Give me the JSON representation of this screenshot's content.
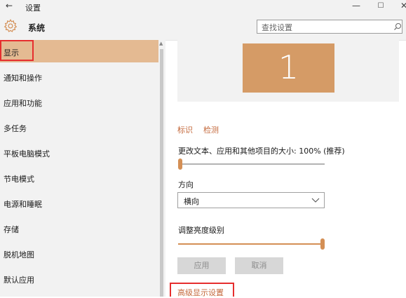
{
  "window": {
    "title": "设置",
    "back_glyph": "←",
    "minimize_glyph": "—",
    "maximize_glyph": "☐",
    "close_glyph": "✕"
  },
  "header": {
    "section_title": "系统",
    "icon": "gear-icon"
  },
  "search": {
    "placeholder": "查找设置",
    "icon": "search-icon"
  },
  "sidebar": {
    "items": [
      {
        "label": "显示",
        "selected": true
      },
      {
        "label": "通知和操作"
      },
      {
        "label": "应用和功能"
      },
      {
        "label": "多任务"
      },
      {
        "label": "平板电脑模式"
      },
      {
        "label": "节电模式"
      },
      {
        "label": "电源和睡眠"
      },
      {
        "label": "存储"
      },
      {
        "label": "脱机地图"
      },
      {
        "label": "默认应用"
      }
    ]
  },
  "display": {
    "monitor_number": "1",
    "identify_link": "标识",
    "detect_link": "检测",
    "scale_label": "更改文本、应用和其他项目的大小: 100% (推荐)",
    "scale_slider_level": 0.0,
    "orientation_label": "方向",
    "orientation_value": "横向",
    "brightness_label": "调整亮度级别",
    "brightness_slider_level": 1.0,
    "apply_button": "应用",
    "cancel_button": "取消",
    "advanced_link": "高级显示设置"
  },
  "colors": {
    "accent": "#d48f55",
    "selected_nav": "#e4ba92",
    "monitor": "#d59b66",
    "link": "#c4693c",
    "highlight_box": "#e62e2e"
  }
}
